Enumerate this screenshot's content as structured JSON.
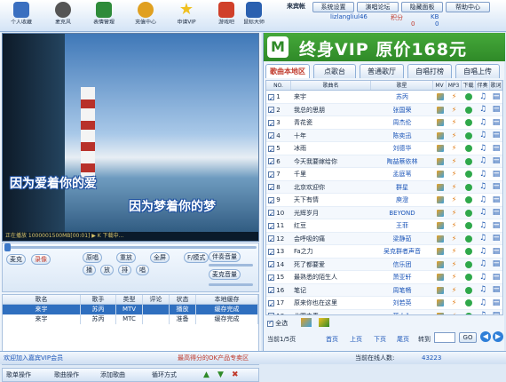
{
  "nav": [
    {
      "label": "个人收藏",
      "icon": "favorites-icon",
      "color": "#3a6fc0"
    },
    {
      "label": "麦克风",
      "icon": "microphone-icon",
      "color": "#4a4a4a"
    },
    {
      "label": "表情管理",
      "icon": "book-icon",
      "color": "#2e8b3a"
    },
    {
      "label": "充值中心",
      "icon": "coins-icon",
      "color": "#e0a020"
    },
    {
      "label": "申请VIP",
      "icon": "star-icon",
      "color": "#f0c020"
    },
    {
      "label": "游戏吧",
      "icon": "game-icon",
      "color": "#d0402a"
    },
    {
      "label": "鼠标大师",
      "icon": "flag-icon",
      "color": "#2a60b0"
    }
  ],
  "header": {
    "guest_label": "来宾帐",
    "buttons": [
      "系统设置",
      "演唱论坛",
      "隐藏面板",
      "帮助中心"
    ],
    "username": "lizlangliul46",
    "points_label": "积分",
    "points": "0",
    "kb_label": "KB",
    "kb": "0"
  },
  "video": {
    "lyric1": "因为爱着你的爱",
    "lyric2": "因为梦着你的梦",
    "status_text": "正在播放 1000001500MB[00:01]   ▶ K 下载中..."
  },
  "controls": {
    "mic_label": "麦克",
    "record_label": "录像",
    "opts": [
      "原唱",
      "重放",
      "全屏",
      "F/模式"
    ],
    "volume_label": "伴奏音量",
    "mic_volume_label": "麦克音量",
    "subtabs": [
      "播",
      "放",
      "排",
      "唱"
    ]
  },
  "queue": {
    "headers": [
      "歌名",
      "歌手",
      "类型",
      "评论",
      "状态",
      "本地缓存"
    ],
    "rows": [
      {
        "name": "来宇",
        "singer": "苏丙",
        "type": "MTV",
        "comment": "",
        "status": "播放",
        "cache": "缓存完成",
        "selected": true
      },
      {
        "name": "来宇",
        "singer": "苏丙",
        "type": "MTC",
        "comment": "",
        "status": "准备",
        "cache": "缓存完成",
        "selected": false
      }
    ],
    "bottom_buttons": [
      "歌单操作",
      "歌曲操作",
      "添加歌曲",
      "循环方式"
    ]
  },
  "banner": {
    "logo": "M",
    "text": "终身VIP 原价168元",
    "bg": "#3a9a30"
  },
  "tabs": [
    "歌曲本地区",
    "点歌台",
    "普通歌厅",
    "自唱打榜",
    "自唱上传"
  ],
  "song_headers": [
    "NO.",
    "歌曲名",
    "歌星",
    "MV",
    "MP3",
    "下载",
    "伴奏",
    "歌词"
  ],
  "songs": [
    {
      "no": "1",
      "name": "来宇",
      "singer": "苏丙"
    },
    {
      "no": "2",
      "name": "我总的思朋",
      "singer": "张国荣"
    },
    {
      "no": "3",
      "name": "青花瓷",
      "singer": "周杰伦"
    },
    {
      "no": "4",
      "name": "十年",
      "singer": "陈奕迅"
    },
    {
      "no": "5",
      "name": "冰雨",
      "singer": "刘德华"
    },
    {
      "no": "6",
      "name": "今天我要嫁给你",
      "singer": "陶喆蔡依林"
    },
    {
      "no": "7",
      "name": "千里",
      "singer": "孟庭苇"
    },
    {
      "no": "8",
      "name": "北京欢迎你",
      "singer": "群星"
    },
    {
      "no": "9",
      "name": "天下有情",
      "singer": "庾澄"
    },
    {
      "no": "10",
      "name": "光辉岁月",
      "singer": "BEYOND"
    },
    {
      "no": "11",
      "name": "红豆",
      "singer": "王菲"
    },
    {
      "no": "12",
      "name": "会呼吸的痛",
      "singer": "梁静茹"
    },
    {
      "no": "13",
      "name": "Fa之力",
      "singer": "吴克群者声音"
    },
    {
      "no": "14",
      "name": "死了都要爱",
      "singer": "信乐团"
    },
    {
      "no": "15",
      "name": "最熟悉的陌生人",
      "singer": "萧亚轩"
    },
    {
      "no": "16",
      "name": "笔记",
      "singer": "周笔畅"
    },
    {
      "no": "17",
      "name": "原来你也在这里",
      "singer": "刘若英"
    },
    {
      "no": "18",
      "name": "北国之春",
      "singer": "蒋大为"
    }
  ],
  "song_footer": {
    "select_all": "全选",
    "page_text": "当前1/5页",
    "first": "首页",
    "prev": "上页",
    "next": "下页",
    "last": "尾页",
    "goto_label": "转到",
    "go": "GO"
  },
  "status": {
    "left": "欢迎加入嘉宾VIP会员",
    "center": "最高得分的OK产品专卖区",
    "online_label": "当前在线人数:",
    "online": "43223"
  }
}
